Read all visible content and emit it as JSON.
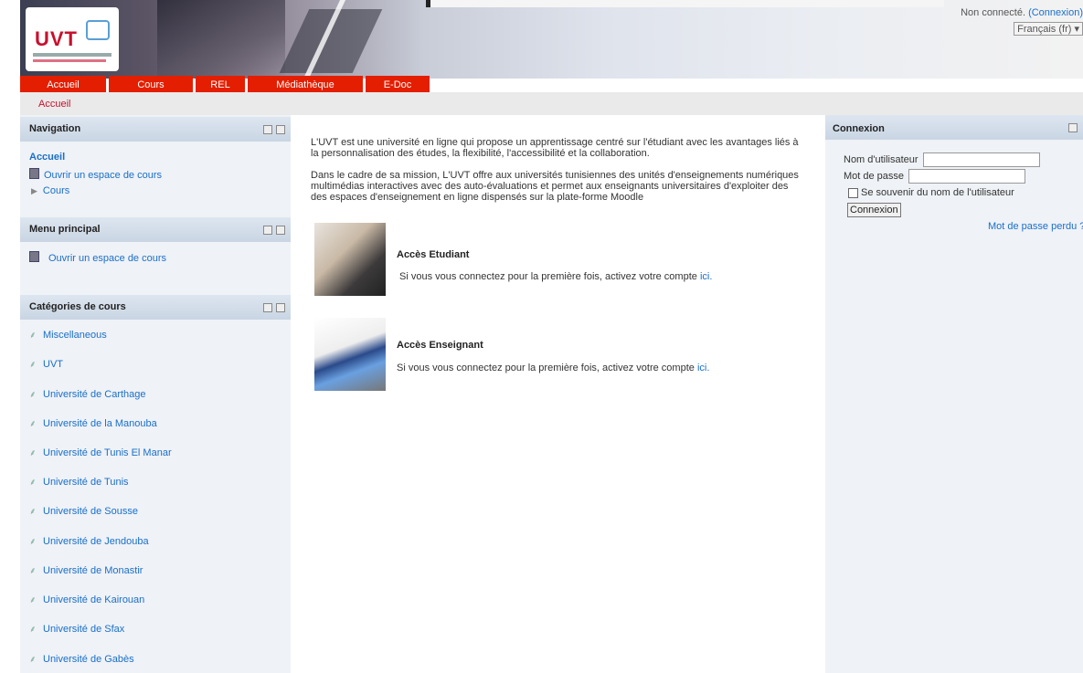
{
  "header": {
    "logo_text": "UVT",
    "login_status": "Non connecté.",
    "login_link": "(Connexion)",
    "language": "Français (fr)"
  },
  "nav": {
    "tabs": [
      "Accueil",
      "Cours",
      "REL",
      "Médiathèque",
      "E-Doc"
    ]
  },
  "breadcrumb": "Accueil",
  "navigation_block": {
    "title": "Navigation",
    "home": "Accueil",
    "open_course": "Ouvrir un espace de cours",
    "courses": "Cours"
  },
  "main_menu_block": {
    "title": "Menu principal",
    "open_course": "Ouvrir un espace de cours"
  },
  "categories_block": {
    "title": "Catégories de cours",
    "items": [
      "Miscellaneous",
      "UVT",
      "Université de Carthage",
      "Université de la Manouba",
      "Université de Tunis El Manar",
      "Université de Tunis",
      "Université de Sousse",
      "Université de Jendouba",
      "Université de Monastir",
      "Université de Kairouan",
      "Université de Sfax",
      "Université de Gabès"
    ]
  },
  "main": {
    "para1": "L'UVT est une université en ligne qui propose un apprentissage centré sur l'étudiant avec les avantages liés à la personnalisation des études, la flexibilité, l'accessibilité et la collaboration.",
    "para2": "Dans le cadre de sa mission, L'UVT offre aux universités tunisiennes des unités d'enseignements numériques multimédias interactives avec des auto-évaluations et permet aux enseignants universitaires d'exploiter des des espaces d'enseignement en ligne dispensés sur la plate-forme Moodle",
    "student_title": "Accès Etudiant",
    "student_text": "Si vous vous connectez pour la première fois, activez votre compte",
    "student_link": "ici.",
    "teacher_title": "Accès Enseignant",
    "teacher_text": "Si vous vous connectez pour la première fois, activez votre compte",
    "teacher_link": "ici."
  },
  "login_block": {
    "title": "Connexion",
    "username_label": "Nom d'utilisateur",
    "password_label": "Mot de passe",
    "remember_label": "Se souvenir du nom de l'utilisateur",
    "submit_label": "Connexion",
    "forgot_label": "Mot de passe perdu ?"
  }
}
